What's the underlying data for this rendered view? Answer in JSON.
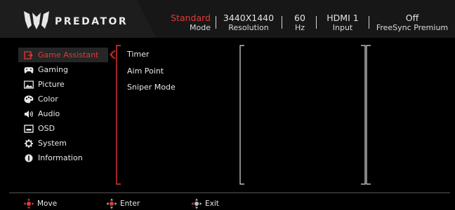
{
  "header": {
    "brand": "PREDATOR",
    "stats": [
      {
        "value": "Standard",
        "label": "Mode"
      },
      {
        "value": "3440X1440",
        "label": "Resolution"
      },
      {
        "value": "60",
        "label": "Hz"
      },
      {
        "value": "HDMI 1",
        "label": "Input"
      },
      {
        "value": "Off",
        "label": "FreeSync Premium"
      }
    ]
  },
  "menu": {
    "items": [
      {
        "label": "Game Assistant",
        "icon": "game-assistant-icon",
        "active": true
      },
      {
        "label": "Gaming",
        "icon": "gamepad-icon"
      },
      {
        "label": "Picture",
        "icon": "picture-icon"
      },
      {
        "label": "Color",
        "icon": "palette-icon"
      },
      {
        "label": "Audio",
        "icon": "speaker-icon"
      },
      {
        "label": "OSD",
        "icon": "osd-icon"
      },
      {
        "label": "System",
        "icon": "gear-icon"
      },
      {
        "label": "Information",
        "icon": "info-icon"
      }
    ]
  },
  "submenu": {
    "items": [
      "Timer",
      "Aim Point",
      "Sniper Mode"
    ]
  },
  "footer": {
    "move": "Move",
    "enter": "Enter",
    "exit": "Exit"
  },
  "colors": {
    "accent": "#e23a3a",
    "header_bg": "#171717",
    "background": "#000000"
  }
}
